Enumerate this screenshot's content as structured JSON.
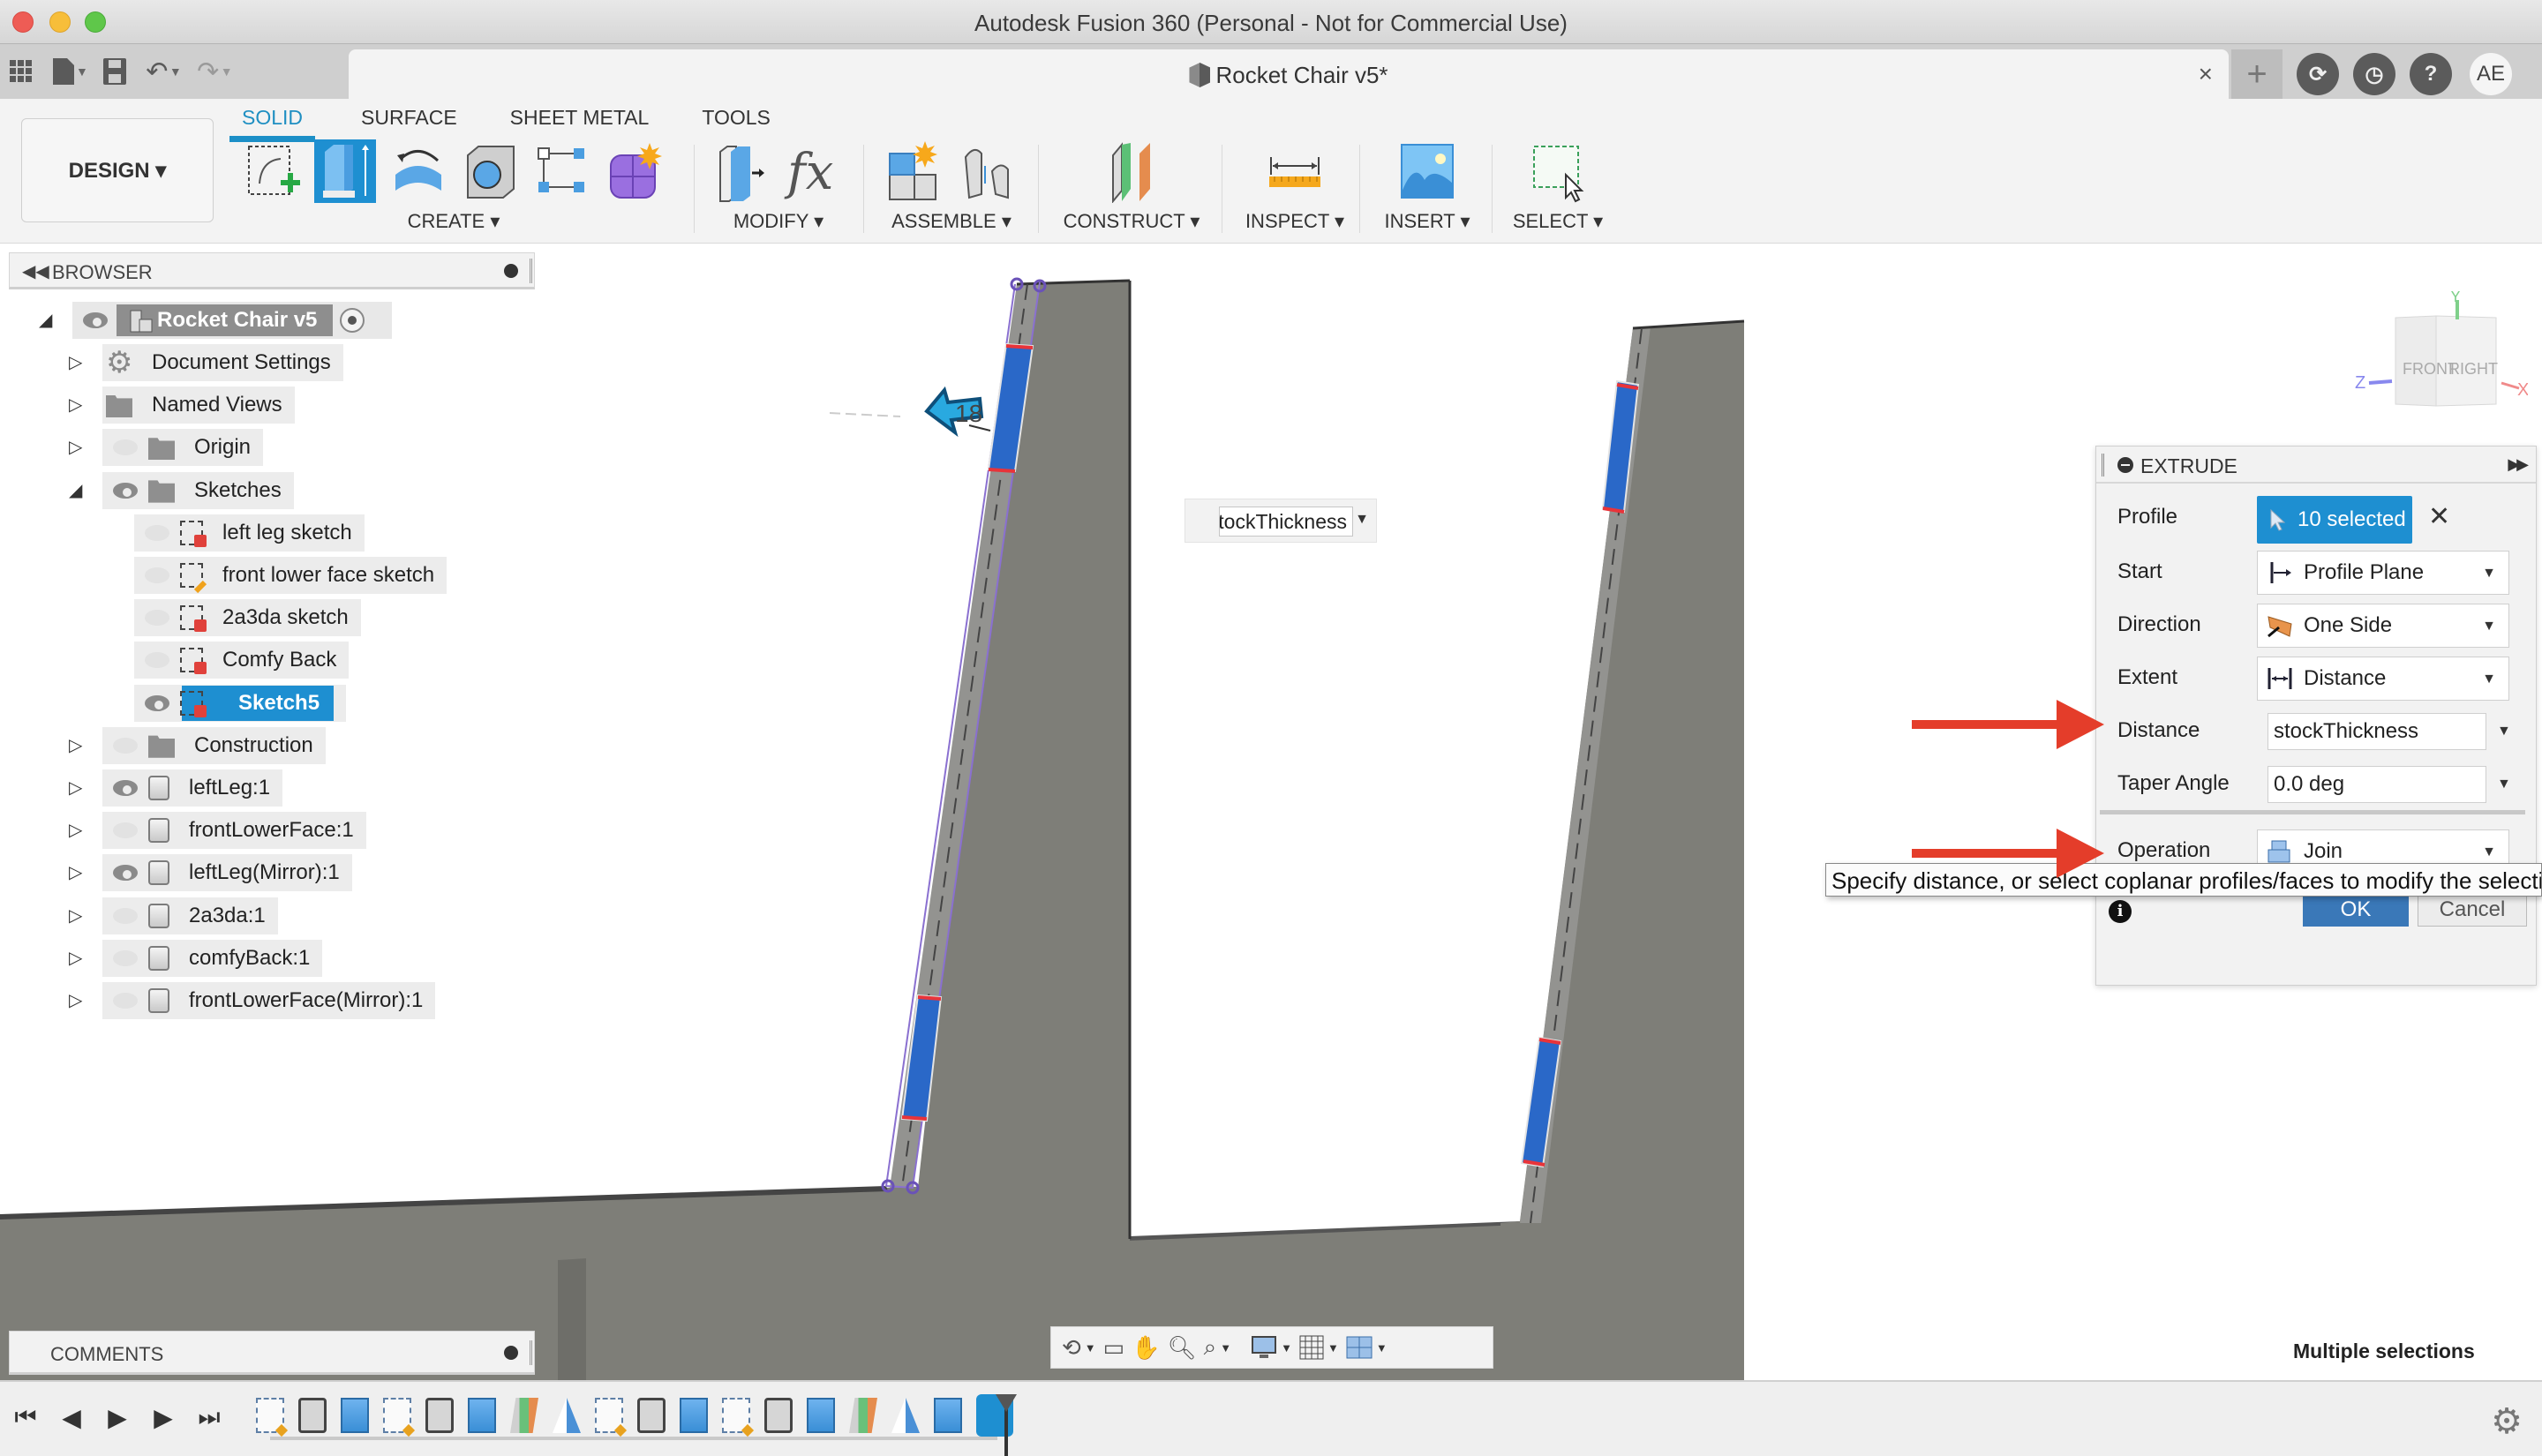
{
  "window": {
    "title": "Autodesk Fusion 360 (Personal - Not for Commercial Use)"
  },
  "tabbar": {
    "document_tab": "Rocket Chair v5*",
    "close_glyph": "×",
    "new_tab_glyph": "+",
    "user_initials": "AE",
    "quick_access": [
      "apps-grid-icon",
      "file-icon",
      "save-icon",
      "undo-icon",
      "redo-icon"
    ],
    "right_icons": [
      "extensions-icon",
      "job-status-icon",
      "help-icon"
    ]
  },
  "ribbon": {
    "workspace": "DESIGN ▾",
    "tabs": [
      {
        "label": "SOLID",
        "active": true
      },
      {
        "label": "SURFACE",
        "active": false
      },
      {
        "label": "SHEET METAL",
        "active": false
      },
      {
        "label": "TOOLS",
        "active": false
      }
    ],
    "groups": [
      {
        "label": "CREATE ▾",
        "icons": [
          "create-sketch-icon",
          "extrude-icon",
          "revolve-icon",
          "hole-icon",
          "pattern-icon",
          "create-form-icon"
        ]
      },
      {
        "label": "MODIFY ▾",
        "icons": [
          "press-pull-icon",
          "parameters-icon"
        ]
      },
      {
        "label": "ASSEMBLE ▾",
        "icons": [
          "new-component-icon",
          "joint-icon"
        ]
      },
      {
        "label": "CONSTRUCT ▾",
        "icons": [
          "offset-plane-icon"
        ]
      },
      {
        "label": "INSPECT ▾",
        "icons": [
          "measure-icon"
        ]
      },
      {
        "label": "INSERT ▾",
        "icons": [
          "insert-image-icon"
        ]
      },
      {
        "label": "SELECT ▾",
        "icons": [
          "select-window-icon"
        ]
      }
    ],
    "accent": "#1c8fc7"
  },
  "browser": {
    "title": "BROWSER",
    "root": {
      "label": "Rocket Chair v5",
      "visible": true
    },
    "items": [
      {
        "label": "Document Settings",
        "icon": "gear",
        "visible": null,
        "level": 1,
        "expanded": false
      },
      {
        "label": "Named Views",
        "icon": "folder",
        "visible": null,
        "level": 1,
        "expanded": false
      },
      {
        "label": "Origin",
        "icon": "folder",
        "visible": false,
        "level": 1,
        "expanded": false
      },
      {
        "label": "Sketches",
        "icon": "folder",
        "visible": true,
        "level": 1,
        "expanded": true
      },
      {
        "label": "left leg sketch",
        "icon": "sketch-locked",
        "visible": false,
        "level": 2
      },
      {
        "label": "front lower face sketch",
        "icon": "sketch-edit",
        "visible": false,
        "level": 2
      },
      {
        "label": "2a3da sketch",
        "icon": "sketch-locked",
        "visible": false,
        "level": 2
      },
      {
        "label": "Comfy Back",
        "icon": "sketch-locked",
        "visible": false,
        "level": 2
      },
      {
        "label": "Sketch5",
        "icon": "sketch-locked",
        "visible": true,
        "level": 2,
        "selected": true
      },
      {
        "label": "Construction",
        "icon": "folder",
        "visible": false,
        "level": 1,
        "expanded": false
      },
      {
        "label": "leftLeg:1",
        "icon": "body",
        "visible": true,
        "level": 1,
        "expanded": false
      },
      {
        "label": "frontLowerFace:1",
        "icon": "body",
        "visible": false,
        "level": 1,
        "expanded": false
      },
      {
        "label": "leftLeg(Mirror):1",
        "icon": "body",
        "visible": true,
        "level": 1,
        "expanded": false
      },
      {
        "label": "2a3da:1",
        "icon": "body",
        "visible": false,
        "level": 1,
        "expanded": false
      },
      {
        "label": "comfyBack:1",
        "icon": "body",
        "visible": false,
        "level": 1,
        "expanded": false
      },
      {
        "label": "frontLowerFace(Mirror):1",
        "icon": "body",
        "visible": false,
        "level": 1,
        "expanded": false
      }
    ]
  },
  "viewport": {
    "manipulator_value": "18",
    "inline_distance_value": "stockThickness",
    "viewcube": {
      "front": "FRONT",
      "right": "RIGHT",
      "axes": {
        "x": "X",
        "y": "Y",
        "z": "Z"
      }
    },
    "status_text": "Multiple selections"
  },
  "extrude": {
    "title": "EXTRUDE",
    "rows": {
      "profile": {
        "label": "Profile",
        "value": "10 selected"
      },
      "start": {
        "label": "Start",
        "value": "Profile Plane"
      },
      "direction": {
        "label": "Direction",
        "value": "One Side"
      },
      "extent": {
        "label": "Extent",
        "value": "Distance"
      },
      "distance": {
        "label": "Distance",
        "value": "stockThickness"
      },
      "taper": {
        "label": "Taper Angle",
        "value": "0.0 deg"
      },
      "operation": {
        "label": "Operation",
        "value": "Join"
      }
    },
    "ok": "OK",
    "cancel": "Cancel",
    "tooltip": "Specify distance, or select coplanar profiles/faces to modify the selection"
  },
  "comments": {
    "title": "COMMENTS"
  },
  "nav_toolbar": [
    "orbit-icon",
    "look-at-icon",
    "pan-icon",
    "zoom-icon",
    "fit-icon",
    "display-settings-icon",
    "grid-icon",
    "viewports-icon"
  ],
  "timeline": {
    "controls": [
      "skip-to-start-icon",
      "step-back-icon",
      "play-icon",
      "step-forward-icon",
      "skip-to-end-icon"
    ],
    "features": [
      "sketch",
      "body",
      "extrude",
      "sketch",
      "body",
      "extrude",
      "plane",
      "mirror",
      "sketch",
      "body",
      "extrude",
      "sketch",
      "body",
      "extrude",
      "plane",
      "mirror",
      "extrude",
      "active-sketch"
    ]
  },
  "annotations": {
    "arrow_color": "#e43d2a"
  }
}
